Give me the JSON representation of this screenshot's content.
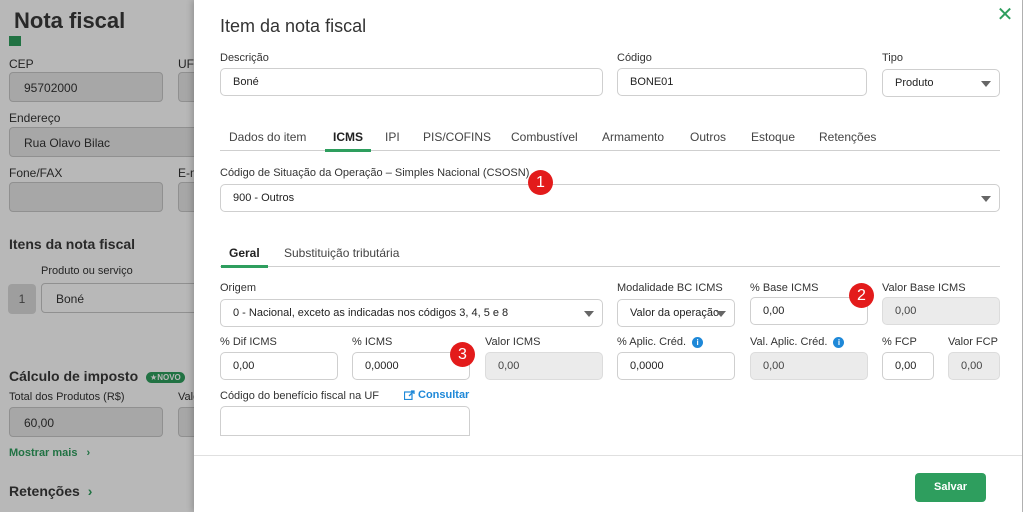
{
  "background": {
    "title": "Nota fiscal",
    "cep_label": "CEP",
    "cep_value": "95702000",
    "uf_label": "UF",
    "endereco_label": "Endereço",
    "endereco_value": "Rua Olavo Bilac",
    "fone_label": "Fone/FAX",
    "email_label": "E-m",
    "itens_title": "Itens da nota fiscal",
    "produto_label": "Produto ou serviço",
    "row_number": "1",
    "produto_value": "Boné",
    "calculo_title": "Cálculo de imposto",
    "novo_badge": "★NOVO",
    "total_label": "Total dos Produtos (R$)",
    "total_value": "60,00",
    "val_label": "Valo",
    "mostrar_mais": "Mostrar mais",
    "retencoes_title": "Retenções"
  },
  "modal": {
    "title": "Item da nota fiscal",
    "descricao_label": "Descrição",
    "descricao_value": "Boné",
    "codigo_label": "Código",
    "codigo_value": "BONE01",
    "tipo_label": "Tipo",
    "tipo_value": "Produto",
    "tabs": [
      "Dados do item",
      "ICMS",
      "IPI",
      "PIS/COFINS",
      "Combustível",
      "Armamento",
      "Outros",
      "Estoque",
      "Retenções"
    ],
    "csosn_label": "Código de Situação da Operação – Simples Nacional (CSOSN)",
    "csosn_value": "900 - Outros",
    "subtabs": [
      "Geral",
      "Substituição tributária"
    ],
    "origem_label": "Origem",
    "origem_value": "0 - Nacional, exceto as indicadas nos códigos 3, 4, 5 e 8",
    "modalidade_label": "Modalidade BC ICMS",
    "modalidade_value": "Valor da operação",
    "base_icms_label": "% Base ICMS",
    "base_icms_value": "0,00",
    "valor_base_label": "Valor Base ICMS",
    "valor_base_value": "0,00",
    "dif_icms_label": "% Dif ICMS",
    "dif_icms_value": "0,00",
    "icms_label": "% ICMS",
    "icms_value": "0,0000",
    "valor_icms_label": "Valor ICMS",
    "valor_icms_value": "0,00",
    "aplic_cred_label": "% Aplic. Créd.",
    "aplic_cred_value": "0,0000",
    "val_aplic_label": "Val. Aplic. Créd.",
    "val_aplic_value": "0,00",
    "fcp_label": "% FCP",
    "fcp_value": "0,00",
    "valor_fcp_label": "Valor FCP",
    "valor_fcp_value": "0,00",
    "beneficio_label": "Código do benefício fiscal na UF",
    "consultar_label": "Consultar",
    "save_label": "Salvar"
  },
  "markers": [
    "1",
    "2",
    "3"
  ],
  "colors": {
    "accent": "#2e9e5e",
    "marker": "#e31b1b",
    "link": "#1e88d8"
  }
}
